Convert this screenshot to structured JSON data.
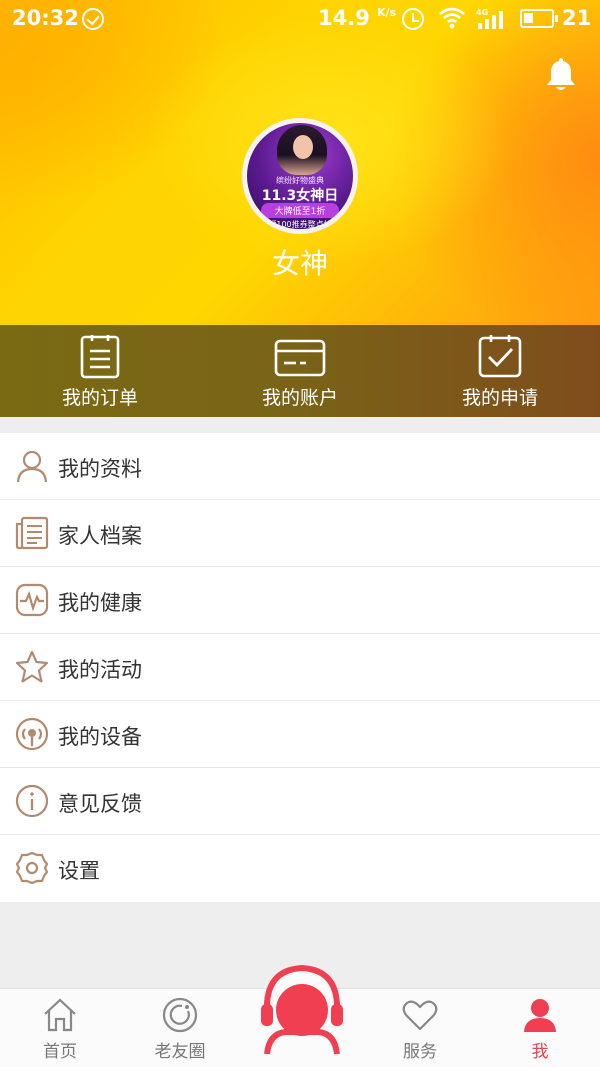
{
  "status_bar": {
    "time": "20:32",
    "speed": "14.9",
    "speed_unit": "K/s",
    "battery_level": "21",
    "network": "4G"
  },
  "profile": {
    "name": "女神",
    "avatar_lines": [
      "缤纷好物盛典",
      "11.3女神日",
      "大牌低至1折",
      "领100推券整点抢"
    ]
  },
  "quick_actions": [
    {
      "label": "我的订单",
      "icon": "order-icon"
    },
    {
      "label": "我的账户",
      "icon": "card-icon"
    },
    {
      "label": "我的申请",
      "icon": "apply-icon"
    }
  ],
  "menu": [
    {
      "label": "我的资料",
      "icon": "person-icon"
    },
    {
      "label": "家人档案",
      "icon": "archive-icon"
    },
    {
      "label": "我的健康",
      "icon": "health-icon"
    },
    {
      "label": "我的活动",
      "icon": "star-icon"
    },
    {
      "label": "我的设备",
      "icon": "device-icon"
    },
    {
      "label": "意见反馈",
      "icon": "info-icon"
    },
    {
      "label": "设置",
      "icon": "settings-icon"
    }
  ],
  "tabs": [
    {
      "label": "首页",
      "icon": "home-icon"
    },
    {
      "label": "老友圈",
      "icon": "circle-icon"
    },
    {
      "label": "服务",
      "icon": "heart-icon"
    },
    {
      "label": "我",
      "icon": "me-icon"
    }
  ],
  "colors": {
    "accent": "#f03f50",
    "icon_brown": "#b48a6e",
    "quickbar": "#7a6417"
  }
}
